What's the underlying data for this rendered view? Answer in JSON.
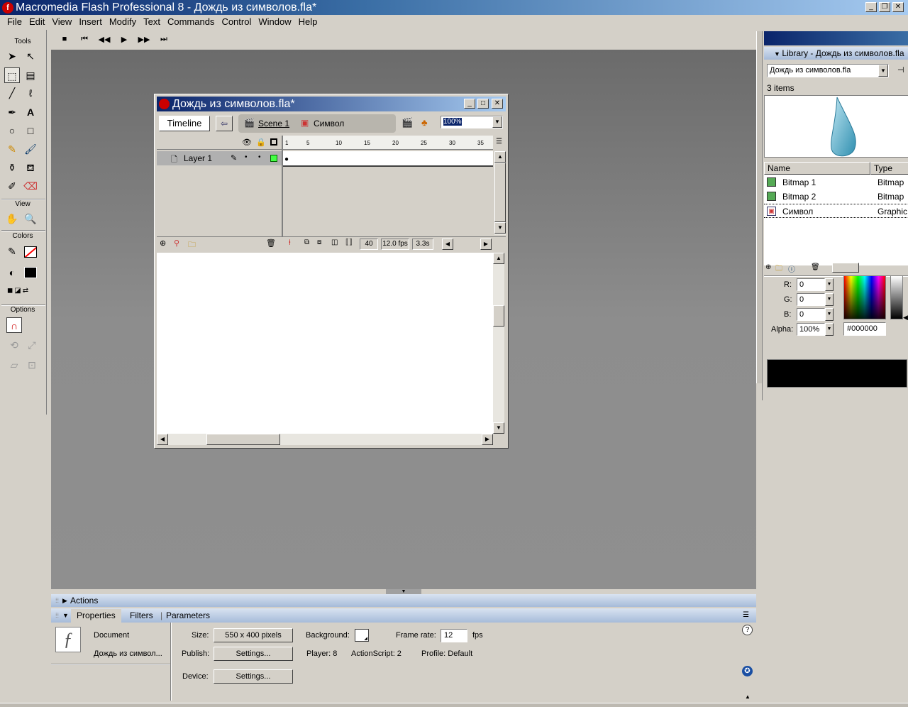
{
  "app": {
    "title": "Macromedia Flash Professional 8 - Дождь из символов.fla*",
    "icon_letter": "f"
  },
  "menu": [
    "File",
    "Edit",
    "View",
    "Insert",
    "Modify",
    "Text",
    "Commands",
    "Control",
    "Window",
    "Help"
  ],
  "tools": {
    "title": "Tools",
    "view": "View",
    "colors": "Colors",
    "options": "Options"
  },
  "doc": {
    "title": "Дождь из символов.fla*",
    "timeline_btn": "Timeline",
    "scene": "Scene 1",
    "symbol": "Символ",
    "zoom": "100%",
    "layer": "Layer 1",
    "ticks": [
      "1",
      "5",
      "10",
      "15",
      "20",
      "25",
      "30",
      "35"
    ],
    "frame": "40",
    "fps": "12.0 fps",
    "time": "3.3s"
  },
  "library": {
    "title": "Library - Дождь из символов.fla",
    "doc": "Дождь из символов.fla",
    "count": "3 items",
    "col_name": "Name",
    "col_type": "Type",
    "items": [
      {
        "name": "Bitmap 1",
        "type": "Bitmap"
      },
      {
        "name": "Bitmap 2",
        "type": "Bitmap"
      },
      {
        "name": "Символ",
        "type": "Graphic"
      }
    ]
  },
  "mixer": {
    "r_label": "R:",
    "g_label": "G:",
    "b_label": "B:",
    "alpha_label": "Alpha:",
    "r": "0",
    "g": "0",
    "b": "0",
    "alpha": "100%",
    "hex": "#000000",
    "swatch_color": "#000000"
  },
  "panels": {
    "actions": "Actions",
    "properties": "Properties",
    "filters": "Filters",
    "parameters": "Parameters"
  },
  "props": {
    "type": "Document",
    "name": "Дождь из символ...",
    "size_label": "Size:",
    "size": "550 x 400 pixels",
    "background_label": "Background:",
    "framerate_label": "Frame rate:",
    "framerate": "12",
    "fps": "fps",
    "publish_label": "Publish:",
    "settings": "Settings...",
    "player": "Player: 8",
    "actionscript": "ActionScript:  2",
    "profile": "Profile:  Default",
    "device_label": "Device:",
    "device_settings": "Settings..."
  }
}
